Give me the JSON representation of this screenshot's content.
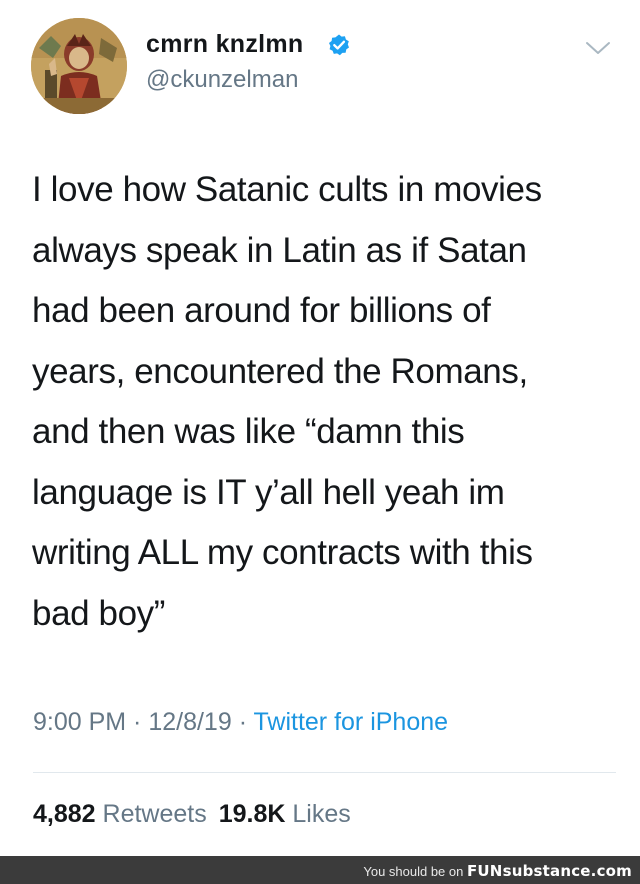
{
  "user": {
    "display_name": "cmrn knzlmn",
    "handle": "@ckunzelman",
    "verified": true
  },
  "tweet": {
    "lines": [
      "I love how Satanic cults in movies",
      "always speak in Latin as if Satan",
      "had been around for billions of",
      "years, encountered the Romans,",
      "and then was like “damn this",
      "language is IT y’all hell yeah im",
      "writing ALL my contracts with this",
      "bad boy”"
    ],
    "time": "9:00 PM",
    "date": "12/8/19",
    "separator": " · ",
    "source": "Twitter for iPhone"
  },
  "stats": {
    "retweets_count": "4,882",
    "retweets_label": "Retweets",
    "likes_count": "19.8K",
    "likes_label": "Likes"
  },
  "footer": {
    "prefix": "You should be on ",
    "brand": "FUNsubstance.com"
  },
  "icons": {
    "verified": "verified-badge-icon",
    "chevron": "chevron-down-icon"
  },
  "colors": {
    "text": "#14171a",
    "secondary": "#657786",
    "link": "#1b95e0",
    "verified": "#1da1f2",
    "footer_bg": "#3b3b3b"
  }
}
